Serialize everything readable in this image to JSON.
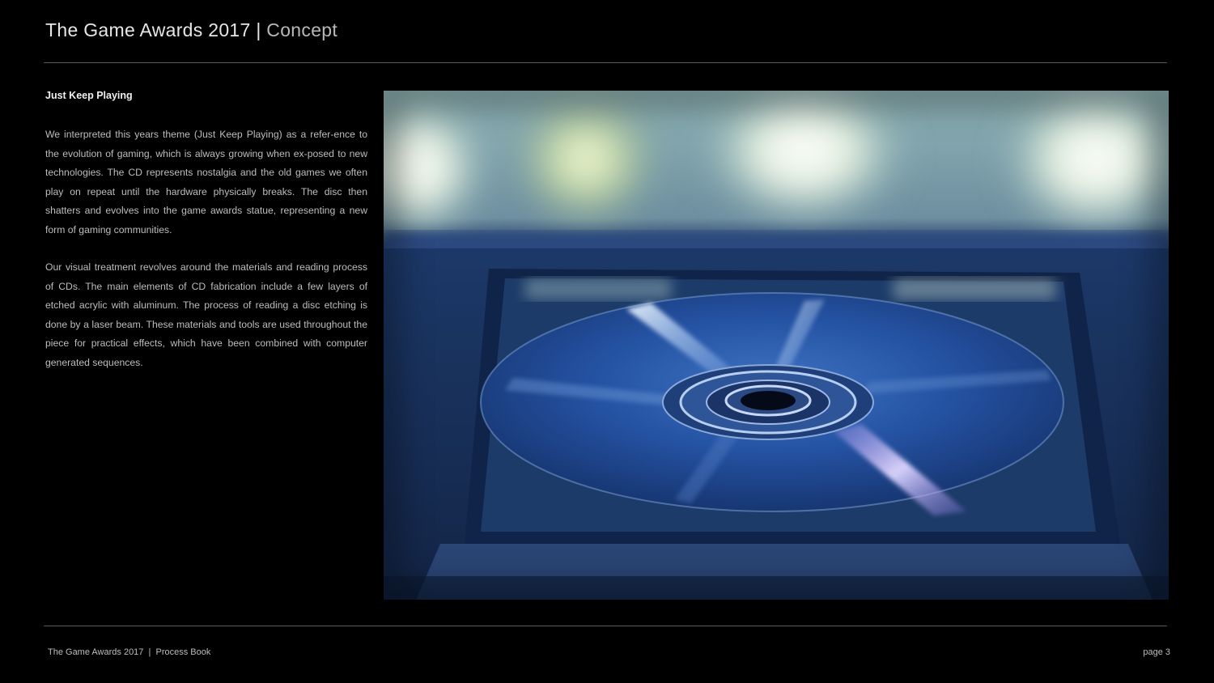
{
  "header": {
    "title": "The Game Awards 2017",
    "separator": "|",
    "subtitle": "Concept"
  },
  "section": {
    "heading": "Just Keep Playing",
    "paragraphs": [
      "We interpreted this years theme (Just Keep Playing) as a refer-ence to the evolution of gaming, which is always growing when ex-posed to new technologies.  The CD represents nostalgia and the old games we often play on repeat until the hardware physically breaks.  The disc then shatters and evolves into the game awards statue, representing a new form of gaming communities.",
      "Our visual treatment revolves around the materials and reading process of CDs.  The main elements of CD fabrication include a few layers of etched acrylic with aluminum.  The process of reading a disc etching is done by a laser beam.  These materials and tools are used throughout the piece for practical effects, which have been combined with computer generated sequences."
    ]
  },
  "image": {
    "subject": "cd-in-disc-tray-photo"
  },
  "footer": {
    "left": "The Game Awards 2017  |  Process Book",
    "right": "page 3"
  },
  "colors": {
    "background": "#000000",
    "rule": "#5a5a5a",
    "text": "#bdbdbd",
    "heading": "#f0f0f0"
  }
}
